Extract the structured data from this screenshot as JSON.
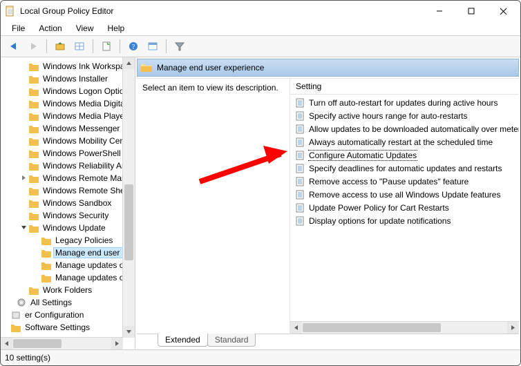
{
  "window": {
    "title": "Local Group Policy Editor"
  },
  "menu": {
    "items": [
      "File",
      "Action",
      "View",
      "Help"
    ]
  },
  "toolbar": {
    "buttons": [
      {
        "name": "back-icon",
        "glyph": "arrow-left",
        "enabled": true
      },
      {
        "name": "forward-icon",
        "glyph": "arrow-right",
        "enabled": false
      },
      {
        "name": "sep"
      },
      {
        "name": "up-folder-icon",
        "glyph": "folder-up",
        "enabled": true
      },
      {
        "name": "show-tree-icon",
        "glyph": "grid",
        "enabled": true
      },
      {
        "name": "sep"
      },
      {
        "name": "export-icon",
        "glyph": "sheet",
        "enabled": true
      },
      {
        "name": "sep"
      },
      {
        "name": "help-icon",
        "glyph": "help",
        "enabled": true
      },
      {
        "name": "properties-icon",
        "glyph": "props",
        "enabled": true
      },
      {
        "name": "sep"
      },
      {
        "name": "filter-icon",
        "glyph": "funnel",
        "enabled": true
      }
    ]
  },
  "tree": {
    "items": [
      {
        "indent": 1,
        "exp": "",
        "label": "Windows Ink Workspace"
      },
      {
        "indent": 1,
        "exp": "",
        "label": "Windows Installer"
      },
      {
        "indent": 1,
        "exp": "",
        "label": "Windows Logon Options"
      },
      {
        "indent": 1,
        "exp": "",
        "label": "Windows Media Digital Rights Management"
      },
      {
        "indent": 1,
        "exp": "",
        "label": "Windows Media Player"
      },
      {
        "indent": 1,
        "exp": "",
        "label": "Windows Messenger"
      },
      {
        "indent": 1,
        "exp": "",
        "label": "Windows Mobility Center"
      },
      {
        "indent": 1,
        "exp": "",
        "label": "Windows PowerShell"
      },
      {
        "indent": 1,
        "exp": "",
        "label": "Windows Reliability Analysis"
      },
      {
        "indent": 1,
        "exp": ">",
        "label": "Windows Remote Management (WinRM)"
      },
      {
        "indent": 1,
        "exp": "",
        "label": "Windows Remote Shell"
      },
      {
        "indent": 1,
        "exp": "",
        "label": "Windows Sandbox"
      },
      {
        "indent": 1,
        "exp": "",
        "label": "Windows Security"
      },
      {
        "indent": 1,
        "exp": "v",
        "label": "Windows Update"
      },
      {
        "indent": 2,
        "exp": "",
        "label": "Legacy Policies"
      },
      {
        "indent": 2,
        "exp": "",
        "label": "Manage end user experience",
        "selected": true
      },
      {
        "indent": 2,
        "exp": "",
        "label": "Manage updates offered from Windows Update"
      },
      {
        "indent": 2,
        "exp": "",
        "label": "Manage updates offered from Windows Server Update Service"
      },
      {
        "indent": 1,
        "exp": "",
        "label": "Work Folders"
      },
      {
        "indent": 0,
        "exp": "",
        "label": "All Settings",
        "icon": "gear"
      },
      {
        "indent": -1,
        "exp": "",
        "label": "er Configuration",
        "icon": "box",
        "cut": true
      },
      {
        "indent": 0,
        "exp": "",
        "label": "Software Settings",
        "icon": "folder",
        "cut": true
      }
    ]
  },
  "right": {
    "header": "Manage end user experience",
    "description_prompt": "Select an item to view its description.",
    "list_header": "Setting",
    "settings": [
      {
        "label": "Turn off auto-restart for updates during active hours"
      },
      {
        "label": "Specify active hours range for auto-restarts"
      },
      {
        "label": "Allow updates to be downloaded automatically over metered connections"
      },
      {
        "label": "Always automatically restart at the scheduled time"
      },
      {
        "label": "Configure Automatic Updates",
        "selected": true
      },
      {
        "label": "Specify deadlines for automatic updates and restarts"
      },
      {
        "label": "Remove access to \"Pause updates\" feature"
      },
      {
        "label": "Remove access to use all Windows Update features"
      },
      {
        "label": "Update Power Policy for Cart Restarts"
      },
      {
        "label": "Display options for update notifications"
      }
    ],
    "tabs": {
      "extended": "Extended",
      "standard": "Standard",
      "active": "extended"
    }
  },
  "status": {
    "text": "10 setting(s)"
  },
  "annotation": {
    "arrow_color": "#ff0000"
  }
}
